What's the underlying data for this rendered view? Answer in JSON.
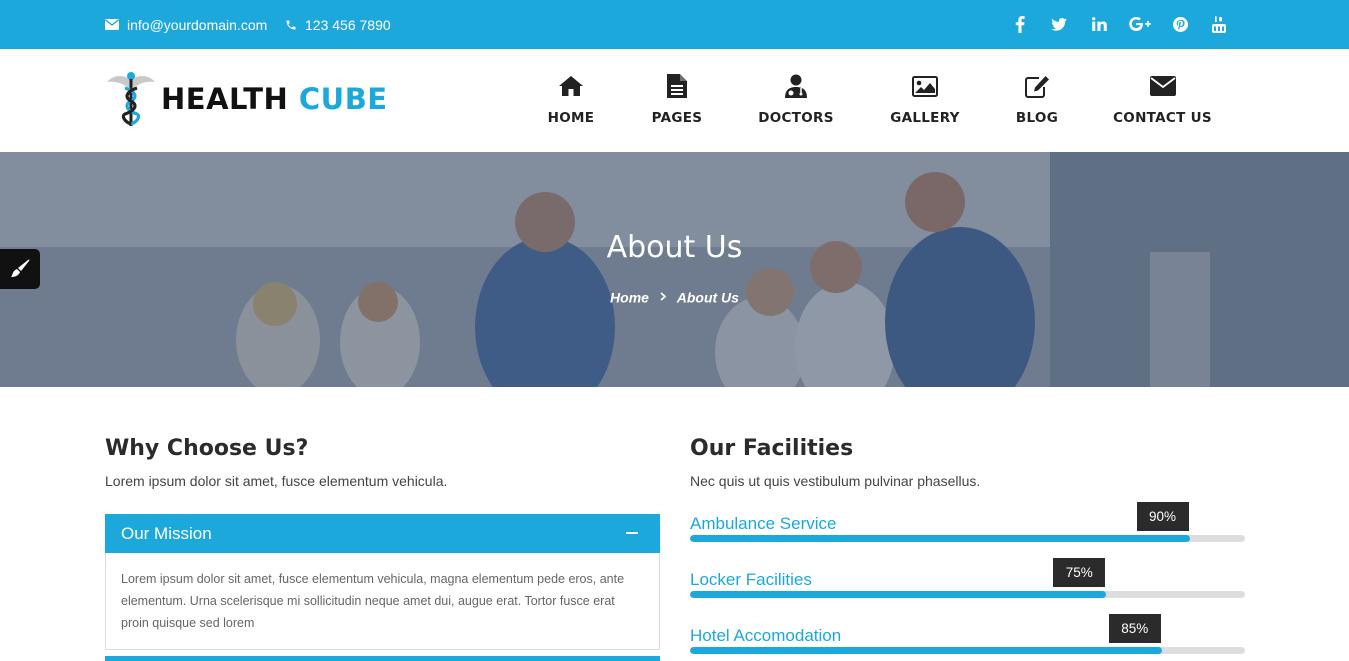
{
  "topbar": {
    "email": "info@yourdomain.com",
    "phone": "123 456 7890",
    "social": [
      "facebook-icon",
      "twitter-icon",
      "linkedin-icon",
      "google-plus-icon",
      "pinterest-icon",
      "youtube-icon"
    ]
  },
  "brand": {
    "part1": "HEALTH",
    "part2": "CUBE",
    "accent": "#1da8dc"
  },
  "nav": [
    {
      "label": "HOME",
      "icon": "home-icon"
    },
    {
      "label": "PAGES",
      "icon": "document-icon"
    },
    {
      "label": "DOCTORS",
      "icon": "doctor-icon"
    },
    {
      "label": "GALLERY",
      "icon": "image-icon"
    },
    {
      "label": "BLOG",
      "icon": "edit-icon"
    },
    {
      "label": "CONTACT US",
      "icon": "envelope-icon"
    }
  ],
  "banner": {
    "title": "About Us",
    "breadcrumb": [
      "Home",
      "About Us"
    ]
  },
  "why": {
    "title": "Why Choose Us?",
    "subtitle": "Lorem ipsum dolor sit amet, fusce elementum vehicula.",
    "accordion": {
      "title": "Our Mission",
      "body": "Lorem ipsum dolor sit amet, fusce elementum vehicula, magna elementum pede eros, ante elementum. Urna scelerisque mi sollicitudin neque amet dui, augue erat. Tortor fusce erat proin quisque sed lorem"
    }
  },
  "facilities": {
    "title": "Our Facilities",
    "subtitle": "Nec quis ut quis vestibulum pulvinar phasellus.",
    "items": [
      {
        "label": "Ambulance Service",
        "percent": 90,
        "percent_text": "90%"
      },
      {
        "label": "Locker Facilities",
        "percent": 75,
        "percent_text": "75%"
      },
      {
        "label": "Hotel Accomodation",
        "percent": 85,
        "percent_text": "85%"
      }
    ]
  }
}
